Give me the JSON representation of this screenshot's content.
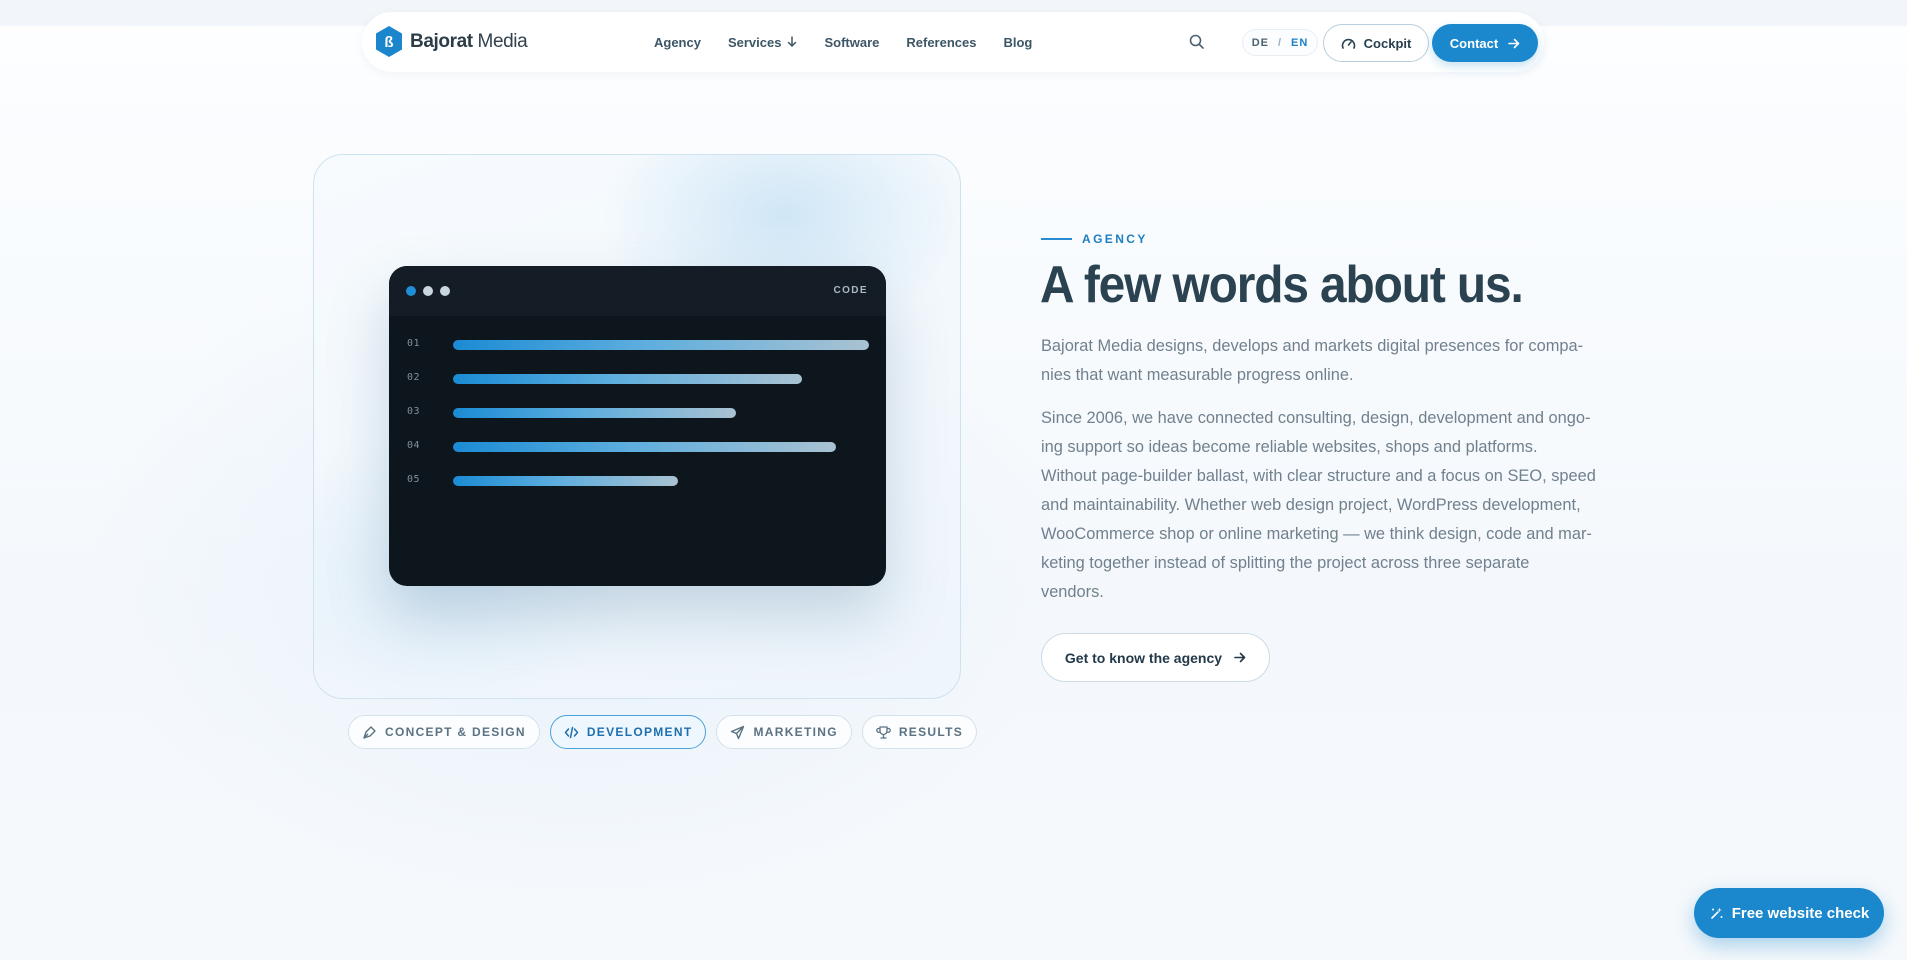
{
  "brand": {
    "name_bold": "Bajorat",
    "name_rest": " Media",
    "logo_glyph": "ß"
  },
  "nav": {
    "links": [
      {
        "label": "Agency"
      },
      {
        "label": "Services",
        "has_dropdown": true
      },
      {
        "label": "Software"
      },
      {
        "label": "References"
      },
      {
        "label": "Blog"
      }
    ],
    "search_icon": "search-icon",
    "lang": {
      "de": "DE",
      "sep": "/",
      "en": "EN",
      "active": "EN"
    },
    "cockpit_label": "Cockpit",
    "contact_label": "Contact"
  },
  "visual": {
    "window_label": "CODE",
    "line_numbers": [
      "01",
      "02",
      "03",
      "04",
      "05"
    ],
    "line_fill_fractions": [
      1.0,
      0.84,
      0.68,
      0.92,
      0.54
    ]
  },
  "chips": [
    {
      "label": "CONCEPT & DESIGN",
      "icon": "pen-tool-icon",
      "active": false
    },
    {
      "label": "DEVELOPMENT",
      "icon": "code-icon",
      "active": true
    },
    {
      "label": "MARKETING",
      "icon": "send-icon",
      "active": false
    },
    {
      "label": "RESULTS",
      "icon": "trophy-icon",
      "active": false
    }
  ],
  "about": {
    "eyebrow": "AGENCY",
    "headline": "A few words about us.",
    "paragraph_1": "Bajorat Media designs, develops and markets digital presences for compa-nies that want measurable progress online.",
    "paragraph_2": "Since 2006, we have connected consulting, design, development and ongo-ing support so ideas become reliable websites, shops and platforms. Without page-builder ballast, with clear structure and a focus on SEO, speed and maintainability. Whether web design project, WordPress development, WooCommerce shop or online marketing — we think design, code and mar-keting together instead of splitting the project across three separate vendors.",
    "cta_label": "Get to know the agency"
  },
  "floating_cta": {
    "label": "Free website check"
  },
  "colors": {
    "accent": "#1b87cc",
    "heading": "#2b4251",
    "body_text": "#70818d",
    "code_bg": "#0d151d"
  }
}
